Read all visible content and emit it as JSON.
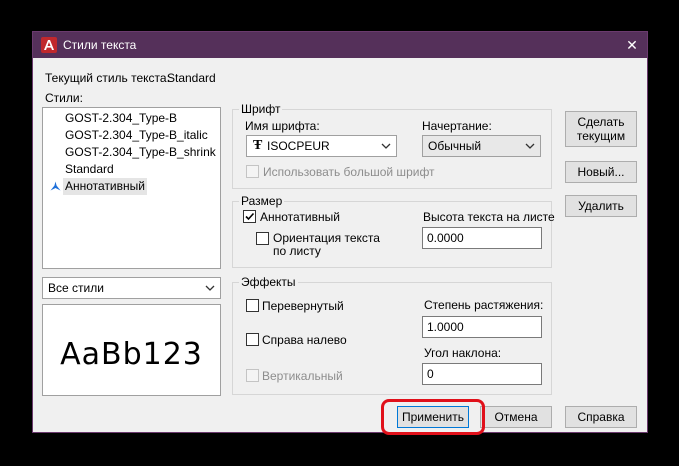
{
  "window": {
    "title": "Стили текста",
    "close_glyph": "✕"
  },
  "current_style": {
    "label": "Текущий стиль текста:",
    "value": "Standard"
  },
  "styles": {
    "label": "Стили:",
    "items": [
      {
        "label": "GOST-2.304_Type-B"
      },
      {
        "label": "GOST-2.304_Type-B_italic"
      },
      {
        "label": "GOST-2.304_Type-B_shrink"
      },
      {
        "label": "Standard"
      },
      {
        "label": "Аннотативный",
        "selected": true,
        "icon": "annotative-icon"
      }
    ],
    "filter_value": "Все стили"
  },
  "preview": {
    "sample_text": "AaBb123"
  },
  "font_group": {
    "title": "Шрифт",
    "font_name_label": "Имя шрифта:",
    "font_name_value": "ISOCPEUR",
    "font_icon": "truetype-icon",
    "font_style_label": "Начертание:",
    "font_style_value": "Обычный",
    "bigfont_label": "Использовать большой шрифт",
    "bigfont_checked": false
  },
  "size_group": {
    "title": "Размер",
    "annotative_label": "Аннотативный",
    "annotative_checked": true,
    "orientation_label_line1": "Ориентация текста",
    "orientation_label_line2": "по листу",
    "orientation_checked": false,
    "height_label": "Высота текста на листе",
    "height_value": "0.0000"
  },
  "effects_group": {
    "title": "Эффекты",
    "upside_down_label": "Перевернутый",
    "upside_down_checked": false,
    "backwards_label": "Справа налево",
    "backwards_checked": false,
    "vertical_label": "Вертикальный",
    "vertical_checked": false,
    "width_factor_label": "Степень растяжения:",
    "width_factor_value": "1.0000",
    "oblique_label": "Угол наклона:",
    "oblique_value": "0"
  },
  "buttons": {
    "set_current": "Сделать текущим",
    "new": "Новый...",
    "delete": "Удалить",
    "apply": "Применить",
    "cancel": "Отмена",
    "help": "Справка"
  },
  "colors": {
    "titlebar": "#55305a",
    "highlight": "#e0101a",
    "annotative_icon": "#1e6fd9"
  }
}
